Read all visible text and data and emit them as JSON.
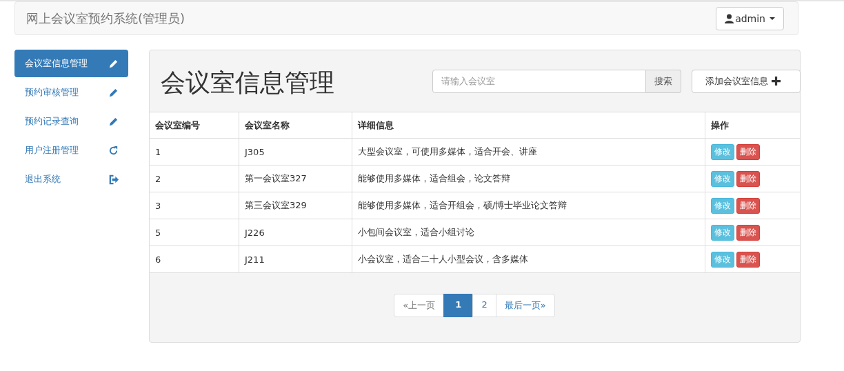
{
  "navbar": {
    "brand": "网上会议室预约系统(管理员)",
    "user_menu": "admin"
  },
  "sidebar": {
    "items": [
      {
        "label": "会议室信息管理",
        "kind": "edit",
        "selected": true
      },
      {
        "label": "预约审核管理",
        "kind": "edit",
        "selected": false
      },
      {
        "label": "预约记录查询",
        "kind": "edit",
        "selected": false
      },
      {
        "label": "用户注册管理",
        "kind": "refresh",
        "selected": false
      },
      {
        "label": "退出系统",
        "kind": "logout",
        "selected": false
      }
    ]
  },
  "panel": {
    "title": "会议室信息管理",
    "search": {
      "placeholder": "请输入会议室",
      "button": "搜索"
    },
    "add_button": "添加会议室信息"
  },
  "table": {
    "columns": [
      "会议室编号",
      "会议室名称",
      "详细信息",
      "操作"
    ],
    "rows": [
      {
        "cells": [
          "1",
          "J305",
          "大型会议室，可使用多媒体，适合开会、讲座"
        ],
        "actions": [
          "修改",
          "删除"
        ]
      },
      {
        "cells": [
          "2",
          "第一会议室327",
          "能够使用多媒体，适合组会，论文答辩"
        ],
        "actions": [
          "修改",
          "删除"
        ]
      },
      {
        "cells": [
          "3",
          "第三会议室329",
          "能够使用多媒体，适合开组会，硕/博士毕业论文答辩"
        ],
        "actions": [
          "修改",
          "删除"
        ]
      },
      {
        "cells": [
          "5",
          "J226",
          "小包间会议室，适合小组讨论"
        ],
        "actions": [
          "修改",
          "删除"
        ]
      },
      {
        "cells": [
          "6",
          "J211",
          "小会议室，适合二十人小型会议，含多媒体"
        ],
        "actions": [
          "修改",
          "删除"
        ]
      }
    ]
  },
  "pagination": [
    {
      "label": "«上一页",
      "selected": false,
      "disabled": true
    },
    {
      "label": "1",
      "selected": true,
      "disabled": false
    },
    {
      "label": "2",
      "selected": false,
      "disabled": false
    },
    {
      "label": "最后一页»",
      "selected": false,
      "disabled": false
    }
  ]
}
